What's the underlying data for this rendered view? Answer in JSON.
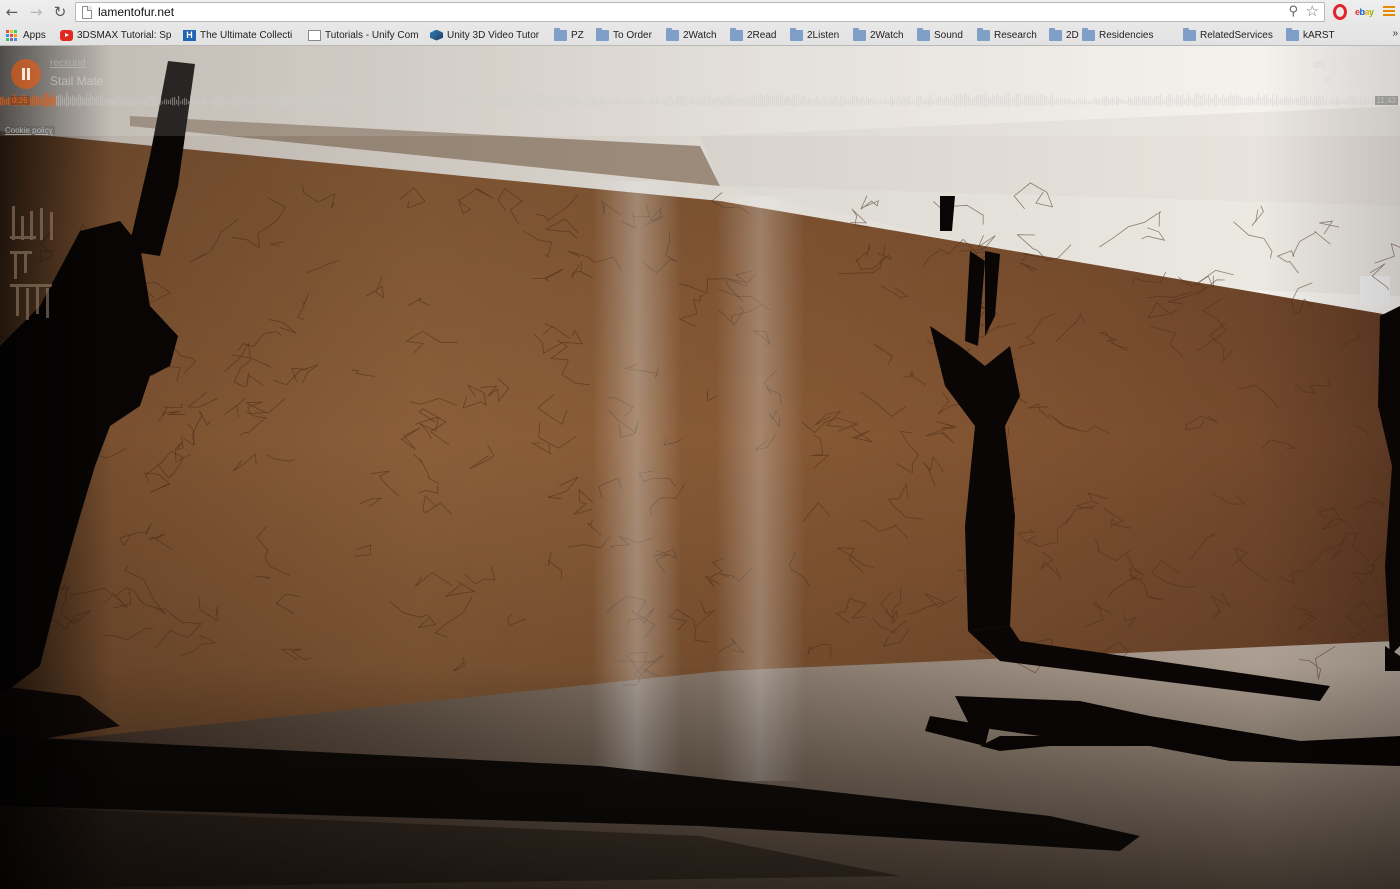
{
  "browser": {
    "url": "lamentofur.net",
    "bookmarks": [
      {
        "label": "Apps",
        "icon": "apps-grid-icon",
        "kind": "apps"
      },
      {
        "label": "3DSMAX Tutorial: Sp",
        "icon": "youtube-icon",
        "kind": "yt"
      },
      {
        "label": "The Ultimate Collecti",
        "icon": "hbox-icon",
        "kind": "hbox"
      },
      {
        "label": "Tutorials - Unify Com",
        "icon": "document-icon",
        "kind": "doc"
      },
      {
        "label": "Unity 3D Video Tutor",
        "icon": "unity-icon",
        "kind": "unity"
      },
      {
        "label": "PZ",
        "icon": "folder-icon",
        "kind": "folder"
      },
      {
        "label": "To Order",
        "icon": "folder-icon",
        "kind": "folder"
      },
      {
        "label": "2Watch",
        "icon": "folder-icon",
        "kind": "folder"
      },
      {
        "label": "2Read",
        "icon": "folder-icon",
        "kind": "folder"
      },
      {
        "label": "2Listen",
        "icon": "folder-icon",
        "kind": "folder"
      },
      {
        "label": "2Watch",
        "icon": "folder-icon",
        "kind": "folder"
      },
      {
        "label": "Sound",
        "icon": "folder-icon",
        "kind": "folder"
      },
      {
        "label": "Research",
        "icon": "folder-icon",
        "kind": "folder"
      },
      {
        "label": "2Do",
        "icon": "folder-icon",
        "kind": "folder"
      },
      {
        "label": "Residencies",
        "icon": "folder-icon",
        "kind": "folder"
      },
      {
        "label": "RelatedServices",
        "icon": "folder-icon",
        "kind": "folder"
      },
      {
        "label": "kARST",
        "icon": "folder-icon",
        "kind": "folder"
      }
    ],
    "more_label": "»"
  },
  "player": {
    "user": "recsund",
    "track": "Stail Mate",
    "brand": "SOUNDCLOUD",
    "share_label": "Share",
    "elapsed": "0:26",
    "duration": "11:43",
    "progress": 0.04,
    "accent": "#ff5500"
  },
  "cookie_policy": "Cookie policy"
}
